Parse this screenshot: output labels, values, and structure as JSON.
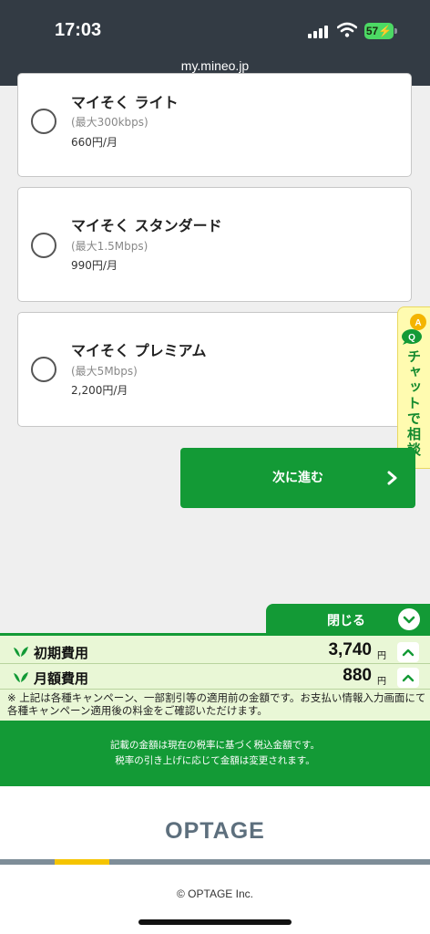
{
  "status_bar": {
    "time": "17:03",
    "battery": "57"
  },
  "browser": {
    "url": "my.mineo.jp"
  },
  "options": [
    {
      "title": "マイそく ライト",
      "speed": "(最大300kbps)",
      "price": "660円/月"
    },
    {
      "title": "マイそく スタンダード",
      "speed": "(最大1.5Mbps)",
      "price": "990円/月"
    },
    {
      "title": "マイそく プレミアム",
      "speed": "(最大5Mbps)",
      "price": "2,200円/月"
    }
  ],
  "chat": {
    "label": "チャットで相談",
    "icon": "qa-chat-icon"
  },
  "next_button": {
    "label": "次に進む"
  },
  "fees": {
    "close_label": "閉じる",
    "initial": {
      "label": "初期費用",
      "amount": "3,740",
      "unit": "円"
    },
    "monthly": {
      "label": "月額費用",
      "amount": "880",
      "unit": "円"
    },
    "note": "※ 上記は各種キャンペーン、一部割引等の適用前の金額です。お支払い情報入力画面にて各種キャンペーン適用後の料金をご確認いただけます。",
    "tax_line1": "記載の金額は現在の税率に基づく税込金額です。",
    "tax_line2": "税率の引き上げに応じて金額は変更されます。"
  },
  "footer": {
    "logo": "OPTAGE",
    "copyright": "© OPTAGE Inc."
  },
  "colors": {
    "brand_green": "#139a36",
    "status_bar": "#333b44",
    "chat_yellow": "#fffbb0"
  }
}
